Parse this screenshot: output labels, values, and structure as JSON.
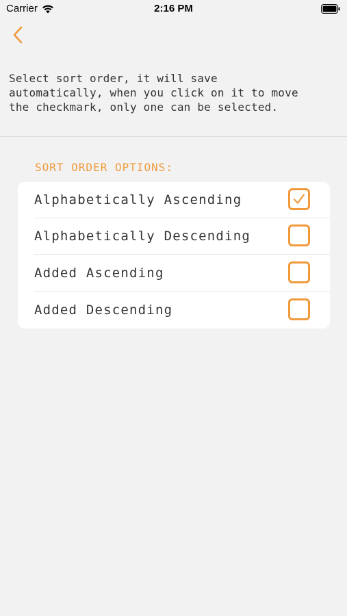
{
  "status_bar": {
    "carrier": "Carrier",
    "time": "2:16 PM"
  },
  "nav": {
    "back_icon": "chevron-left-icon",
    "accent_color": "#f09a3c"
  },
  "instructions": "Select sort order, it will save\nautomatically, when you click on it to move\nthe checkmark, only one can be selected.",
  "section_header": "SORT ORDER OPTIONS:",
  "options": [
    {
      "label": "Alphabetically Ascending",
      "checked": true
    },
    {
      "label": "Alphabetically Descending",
      "checked": false
    },
    {
      "label": "Added Ascending",
      "checked": false
    },
    {
      "label": "Added Descending",
      "checked": false
    }
  ]
}
